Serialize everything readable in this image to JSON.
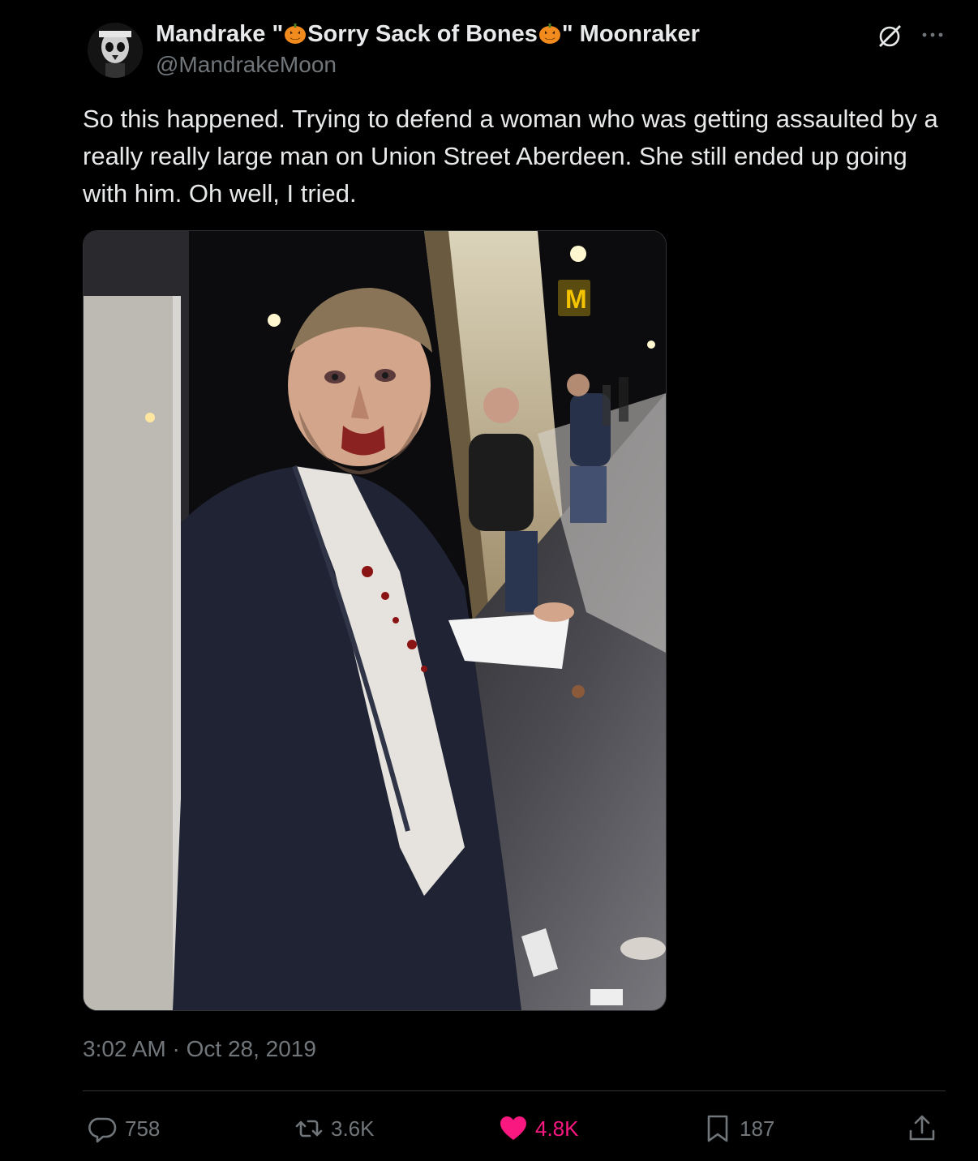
{
  "tweet": {
    "author": {
      "name_parts": [
        "Mandrake \"",
        "Sorry Sack of Bones",
        "\" Moonraker"
      ],
      "handle": "@MandrakeMoon",
      "avatar_icon": "skull-avatar"
    },
    "text": "So this happened. Trying to defend a woman who was getting assaulted by a really really large man on Union Street Aberdeen. She still ended up going with him. Oh well, I tried.",
    "media": {
      "type": "photo",
      "sign_text": "M"
    },
    "timestamp": "3:02 AM · Oct 28, 2019",
    "header_icons": [
      "grok-icon",
      "more-icon"
    ],
    "actions": {
      "reply": {
        "icon": "reply-icon",
        "count": "758"
      },
      "retweet": {
        "icon": "retweet-icon",
        "count": "3.6K"
      },
      "like": {
        "icon": "heart-icon",
        "count": "4.8K",
        "color": "#f91880"
      },
      "bookmark": {
        "icon": "bookmark-icon",
        "count": "187"
      },
      "share": {
        "icon": "share-icon"
      }
    }
  },
  "colors": {
    "background": "#000000",
    "text": "#e7e9ea",
    "secondary": "#71767b",
    "divider": "#2f3336",
    "like": "#f91880"
  }
}
